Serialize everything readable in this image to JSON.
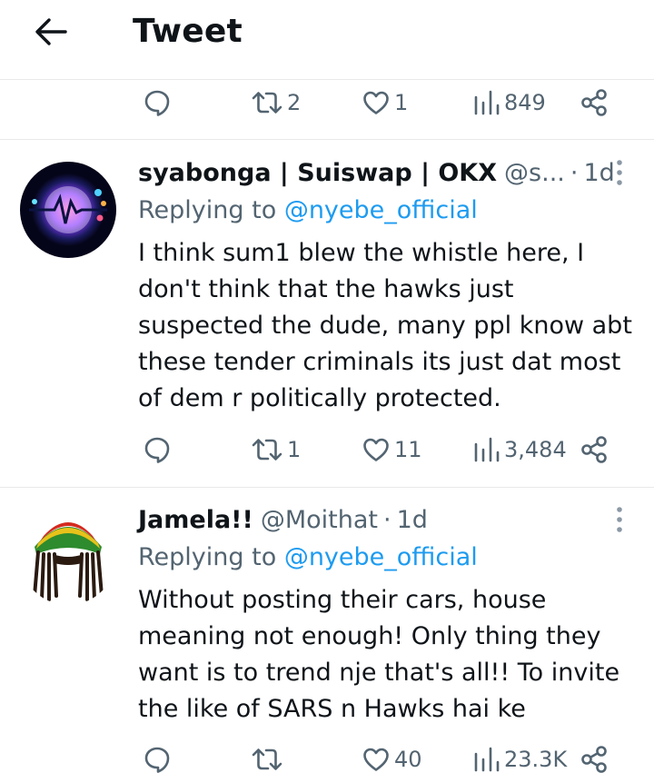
{
  "header": {
    "title": "Tweet",
    "back_icon": "arrow-left-icon"
  },
  "colors": {
    "accent": "#1d9bf0",
    "secondary_text": "#536471",
    "primary_text": "#0f1419",
    "divider": "#e7e9ea"
  },
  "top_actions": {
    "replies": "",
    "retweets": "2",
    "likes": "1",
    "views": "849"
  },
  "tweets": [
    {
      "name": "syabonga | Suiswap | OKX",
      "handle": "@s...",
      "dot": "·",
      "time": "1d",
      "replying_prefix": "Replying to",
      "replying_to": "@nyebe_official",
      "lines": [
        "I think sum1 blew the whistle here, I",
        "don't think that the hawks just",
        "suspected the dude, many ppl know abt",
        "these tender criminals its just dat most",
        "of dem r politically protected."
      ],
      "replies": "",
      "retweets": "1",
      "likes": "11",
      "views": "3,484"
    },
    {
      "name": "Jamela!!",
      "handle": "@Moithat",
      "dot": "·",
      "time": "1d",
      "replying_prefix": "Replying to",
      "replying_to": "@nyebe_official",
      "lines": [
        "Without posting their cars, house",
        "meaning not enough! Only thing they",
        "want is to trend nje that's all!! To invite",
        "the like of SARS n Hawks hai ke"
      ],
      "replies": "",
      "retweets": "",
      "likes": "40",
      "views": "23.3K"
    }
  ]
}
